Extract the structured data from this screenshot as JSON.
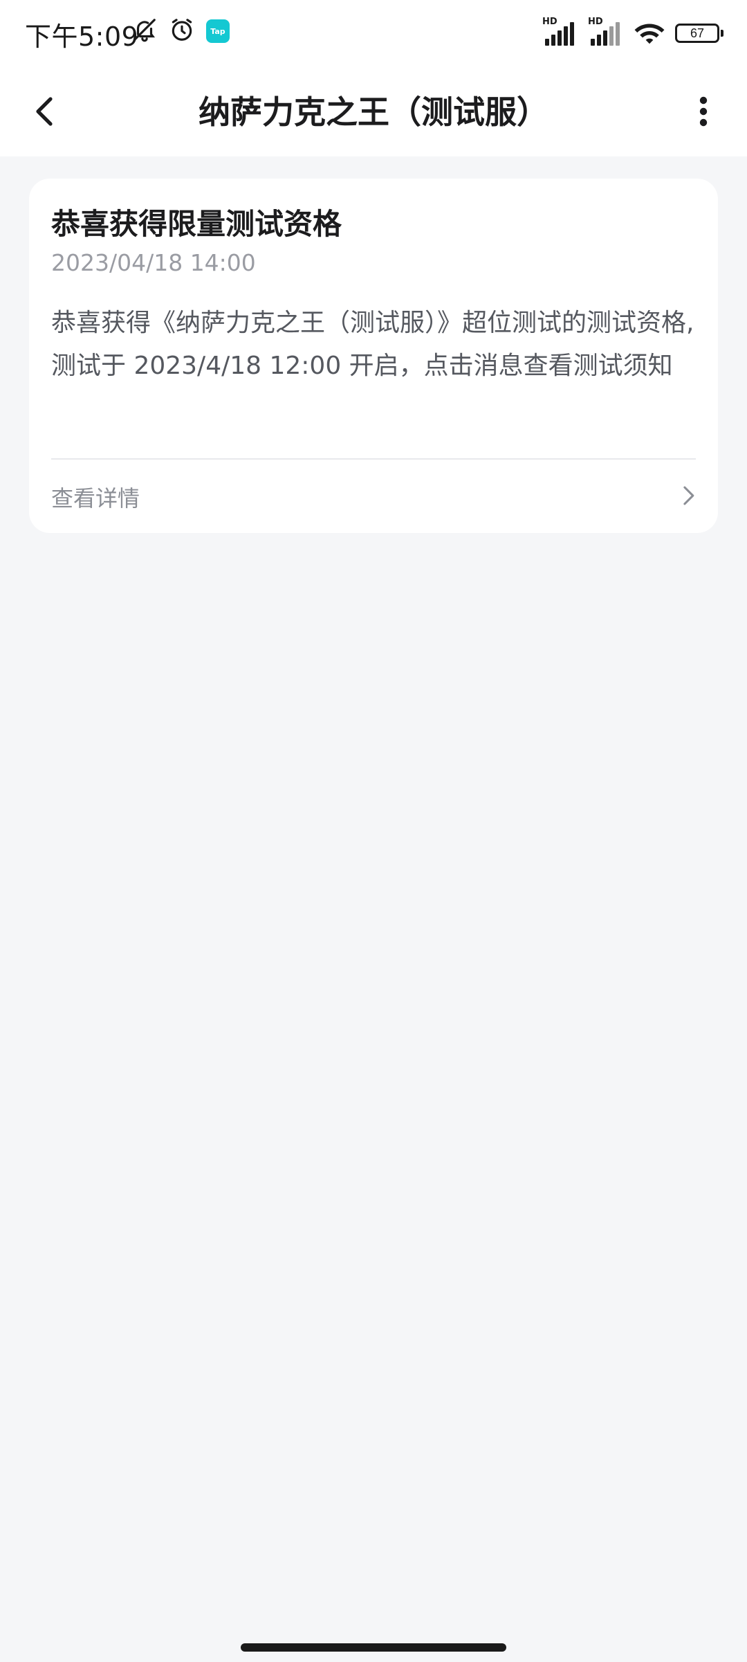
{
  "status_bar": {
    "time": "下午5:09",
    "tap_label": "Tap",
    "signal_1_label": "HD",
    "signal_2_label": "HD",
    "battery": "67"
  },
  "nav": {
    "title": "纳萨力克之王（测试服）"
  },
  "message": {
    "title": "恭喜获得限量测试资格",
    "time": "2023/04/18 14:00",
    "body": "恭喜获得《纳萨力克之王（测试服）》超位测试的测试资格,测试于 2023/4/18 12:00 开启，点击消息查看测试须知",
    "detail_label": "查看详情"
  },
  "colors": {
    "background": "#f5f6f8",
    "card": "#ffffff",
    "accent_tap": "#14c8d2",
    "title_text": "#1c1c1e",
    "secondary_text": "#9a9ca3"
  }
}
